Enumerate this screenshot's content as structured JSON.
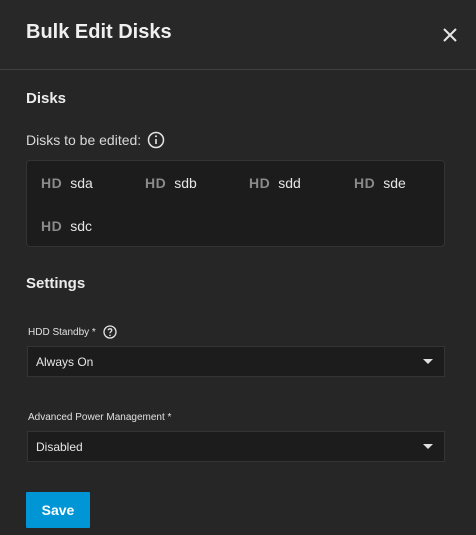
{
  "dialog": {
    "title": "Bulk Edit Disks"
  },
  "disks_section": {
    "title": "Disks",
    "label": "Disks to be edited:",
    "badge": "HD",
    "items": [
      {
        "name": "sda"
      },
      {
        "name": "sdb"
      },
      {
        "name": "sdd"
      },
      {
        "name": "sde"
      },
      {
        "name": "sdc"
      }
    ]
  },
  "settings_section": {
    "title": "Settings",
    "hdd_standby": {
      "label": "HDD Standby *",
      "value": "Always On"
    },
    "advanced_power": {
      "label": "Advanced Power Management *",
      "value": "Disabled"
    }
  },
  "actions": {
    "save_label": "Save"
  },
  "colors": {
    "accent": "#0095d5",
    "background": "#282828",
    "field_bg": "#1c1c1c"
  },
  "icons": {
    "close": "close-icon",
    "info": "info-icon",
    "help": "help-icon",
    "dropdown": "chevron-down-icon"
  }
}
